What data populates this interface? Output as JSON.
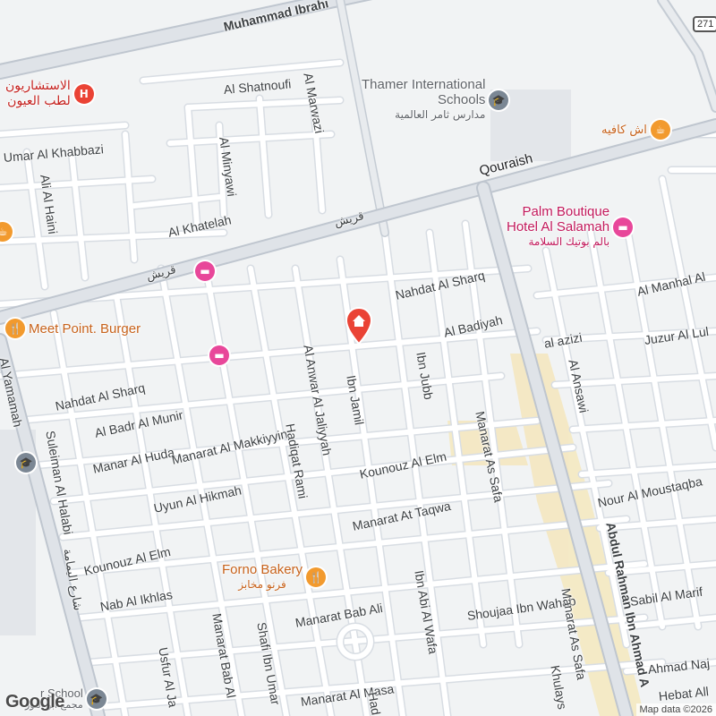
{
  "map": {
    "colors": {
      "background": "#f1f3f4",
      "road": "#ffffff",
      "road_border": "#d6dadf",
      "major_road": "#bfc6cf",
      "highlight_area": "#f5e7bd"
    },
    "location_marker": {
      "icon": "home-icon",
      "color": "#ea4335"
    },
    "route_shield": "271",
    "streets": {
      "muhammad_ibrahim": "Muhammad Ibrahi",
      "al_marwazi": "Al Marwazi",
      "al_shatnoufi": "Al Shatnoufi",
      "umar_al_khabbazi": "Umar Al Khabbazi",
      "al_minyawi": "Al Minyawi",
      "ali_al_haini": "Ali Al Haini",
      "al_khatelah": "Al Khatelah",
      "quraish_ar_1": "قريش",
      "quraish_ar_2": "قريش",
      "quraish": "Qouraish",
      "nahdat_al_sharq_1": "Nahdat Al Sharq",
      "nahdat_al_sharq_2": "Nahdat Al Sharq",
      "al_manhal": "Al Manhal Al",
      "al_badiyah": "Al Badiyah",
      "al_azizi": "al azizi",
      "juzur_al_lu": "Juzur Al Lul",
      "al_yamamah": "Al Yamamah",
      "al_ansawi": "Al Ansawi",
      "al_badr_al_munir": "Al Badr Al Munir",
      "ibn_jamil": "Ibn Jamil",
      "ibn_jubb": "Ibn Jubb",
      "al_anwar_al_jaliyyah": "Al Anwar Al Jaliyyah",
      "manar_al_huda": "Manar Al Huda",
      "manarat_al_makkiyyin": "Manarat Al Makkiyyin",
      "kounouz_al_elm_1": "Kounouz Al Elm",
      "manarat_as_safa_1": "Manarat As Safa",
      "suleiman_al_halabi": "Suleiman Al Halabi",
      "hadiqat_rami": "Hadiqat Rami",
      "uyun_al_hikmah": "Uyun Al Hikmah",
      "nour_al_moustaqbal": "Nour Al Moustaqba",
      "manarat_at_taqwa": "Manarat At Taqwa",
      "kounouz_al_elm_2": "Kounouz Al Elm",
      "al_yamamah_ar": "شارع اليمامة",
      "abdul_rahman": "Abdul Rahman Ibn Ahmad A",
      "nab_al_ikhlas": "Nab Al Ikhlas",
      "ibn_abi_al_wafa": "Ibn Abi Al Wafa",
      "shoujaa_ibn_wahab": "Shoujaa Ibn Wahab",
      "sabil_al_marif": "Sabil Al Marif",
      "manarat_bab_ali_1": "Manarat Bab Ali",
      "manarat_as_safa_2": "Manarat As Safa",
      "manarat_bab_ali_2": "Manarat Bab Al",
      "shafi_ibn_umar": "Shafi Ibn Umar",
      "usfur_al_ja": "Usfur Al Ja",
      "ahmad_naj": "Ahmad Naj",
      "manarat_al_masa": "Manarat Al Masa",
      "khulays": "Khulays",
      "hebat_all": "Hebat All",
      "had": "Had"
    },
    "pois": {
      "eye_clinic": {
        "name_ar_1": "الاستشاريون",
        "name_ar_2": "لطب العيون",
        "icon": "hospital-icon",
        "glyph": "H"
      },
      "thamer_school": {
        "name_1": "Thamer International",
        "name_2": "Schools",
        "name_ar": "مدارس ثامر العالمية",
        "icon": "school-icon",
        "glyph": "🎓"
      },
      "ash_cafe": {
        "name_ar": "اش كافيه",
        "icon": "cafe-icon",
        "glyph": "☕"
      },
      "palm_boutique": {
        "name_1": "Palm Boutique",
        "name_2": "Hotel Al Salamah",
        "name_ar": "بالم بوتيك السلامة",
        "icon": "hotel-icon",
        "glyph": "▬"
      },
      "hotel_left": {
        "icon": "hotel-icon",
        "glyph": "▬"
      },
      "hotel_mid": {
        "icon": "hotel-icon",
        "glyph": "▬"
      },
      "cafe_left": {
        "icon": "cafe-icon",
        "glyph": "☕"
      },
      "meet_point": {
        "name": "Meet Point. Burger",
        "icon": "restaurant-icon",
        "glyph": "🍴"
      },
      "school_left": {
        "icon": "school-icon",
        "glyph": "🎓"
      },
      "forno_bakery": {
        "name": "Forno Bakery",
        "name_ar": "فرنو مخابز",
        "icon": "restaurant-icon",
        "glyph": "🍴"
      },
      "bottom_school": {
        "name_1": "r School",
        "name_2": "مجمع ابو النور",
        "icon": "school-icon",
        "glyph": "🎓"
      }
    },
    "logo": "Google",
    "attribution": "Map data ©2026"
  }
}
